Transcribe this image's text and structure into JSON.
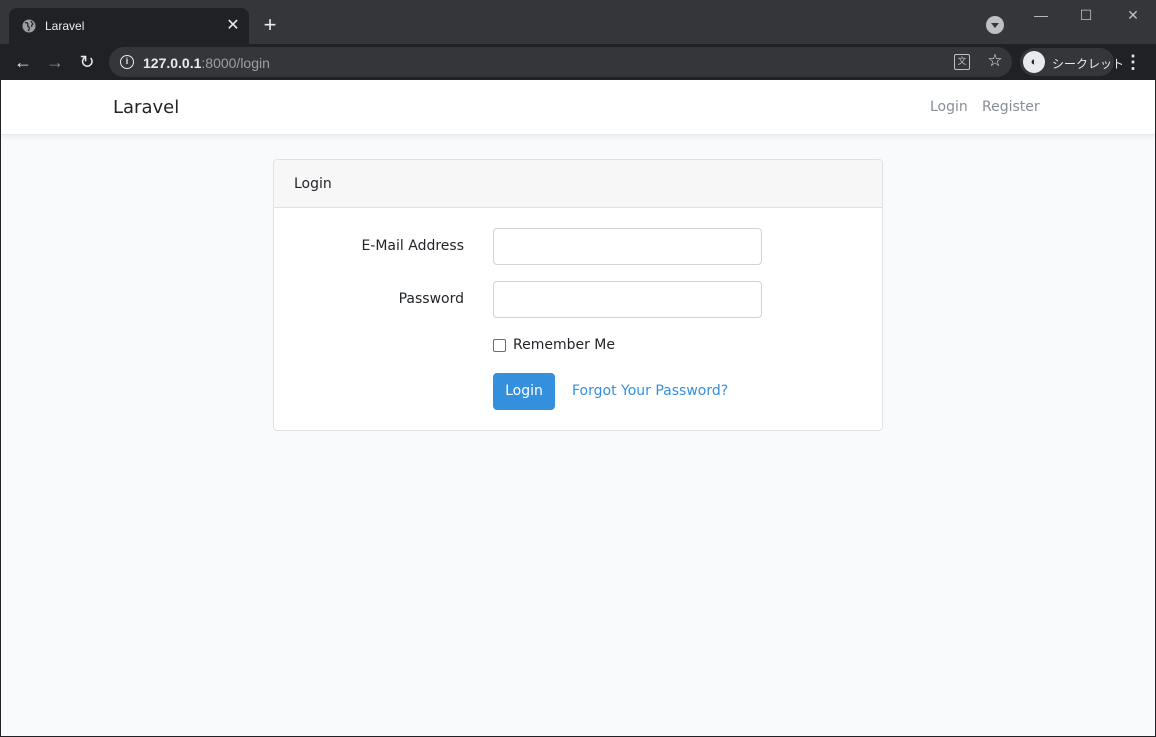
{
  "browser": {
    "tab_title": "Laravel",
    "url_host": "127.0.0.1",
    "url_rest": ":8000/login",
    "incognito_label": "シークレット",
    "icons": {
      "favicon": "globe-icon",
      "close": "close-icon",
      "new_tab": "plus-icon",
      "back": "arrow-left-icon",
      "forward": "arrow-right-icon",
      "reload": "reload-icon",
      "info": "info-icon",
      "translate": "translate-icon",
      "bookmark": "star-icon",
      "menu": "kebab-menu-icon"
    }
  },
  "navbar": {
    "brand": "Laravel",
    "links": {
      "login": "Login",
      "register": "Register"
    }
  },
  "card": {
    "header": "Login",
    "email_label": "E-Mail Address",
    "email_value": "",
    "password_label": "Password",
    "password_value": "",
    "remember_label": "Remember Me",
    "remember_checked": false,
    "submit_label": "Login",
    "forgot_label": "Forgot Your Password?"
  },
  "colors": {
    "primary": "#3490dc",
    "page_background": "#f8fafc",
    "chrome_dark": "#202124",
    "chrome_titlebar": "#35363a"
  }
}
